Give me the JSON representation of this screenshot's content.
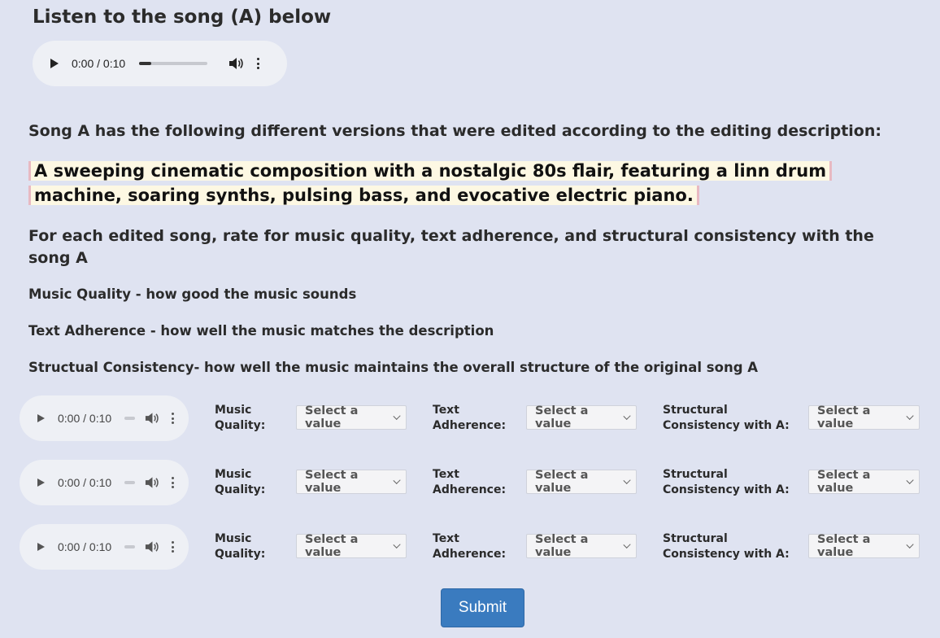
{
  "header": {
    "title": "Listen to the song (A) below"
  },
  "main_player": {
    "time": "0:00 / 0:10",
    "progress": 0.18
  },
  "intro_text": "Song A has the following different versions that were edited according to the editing description:",
  "edit_description": "A sweeping cinematic composition with a nostalgic 80s flair, featuring a linn drum machine, soaring synths, pulsing bass, and evocative electric piano.",
  "instructions": "For each edited song, rate for music quality, text adherence, and structural consistency with the song A",
  "definitions": {
    "music_quality": "Music Quality - how good the music sounds",
    "text_adherence": "Text Adherence - how well the music matches the description",
    "structural_consistency": "Structual Consistency- how well the music maintains the overall structure of the original song A"
  },
  "labels": {
    "music_quality": [
      "Music",
      "Quality:"
    ],
    "text_adherence": [
      "Text",
      "Adherence:"
    ],
    "structural": [
      "Structural",
      "Consistency with A:"
    ]
  },
  "rows": [
    {
      "time": "0:00 / 0:10",
      "progress": 0.0,
      "mq": "Select a value",
      "ta": "Select a value",
      "sc": "Select a value"
    },
    {
      "time": "0:00 / 0:10",
      "progress": 0.0,
      "mq": "Select a value",
      "ta": "Select a value",
      "sc": "Select a value"
    },
    {
      "time": "0:00 / 0:10",
      "progress": 0.0,
      "mq": "Select a value",
      "ta": "Select a value",
      "sc": "Select a value"
    }
  ],
  "submit_label": "Submit"
}
